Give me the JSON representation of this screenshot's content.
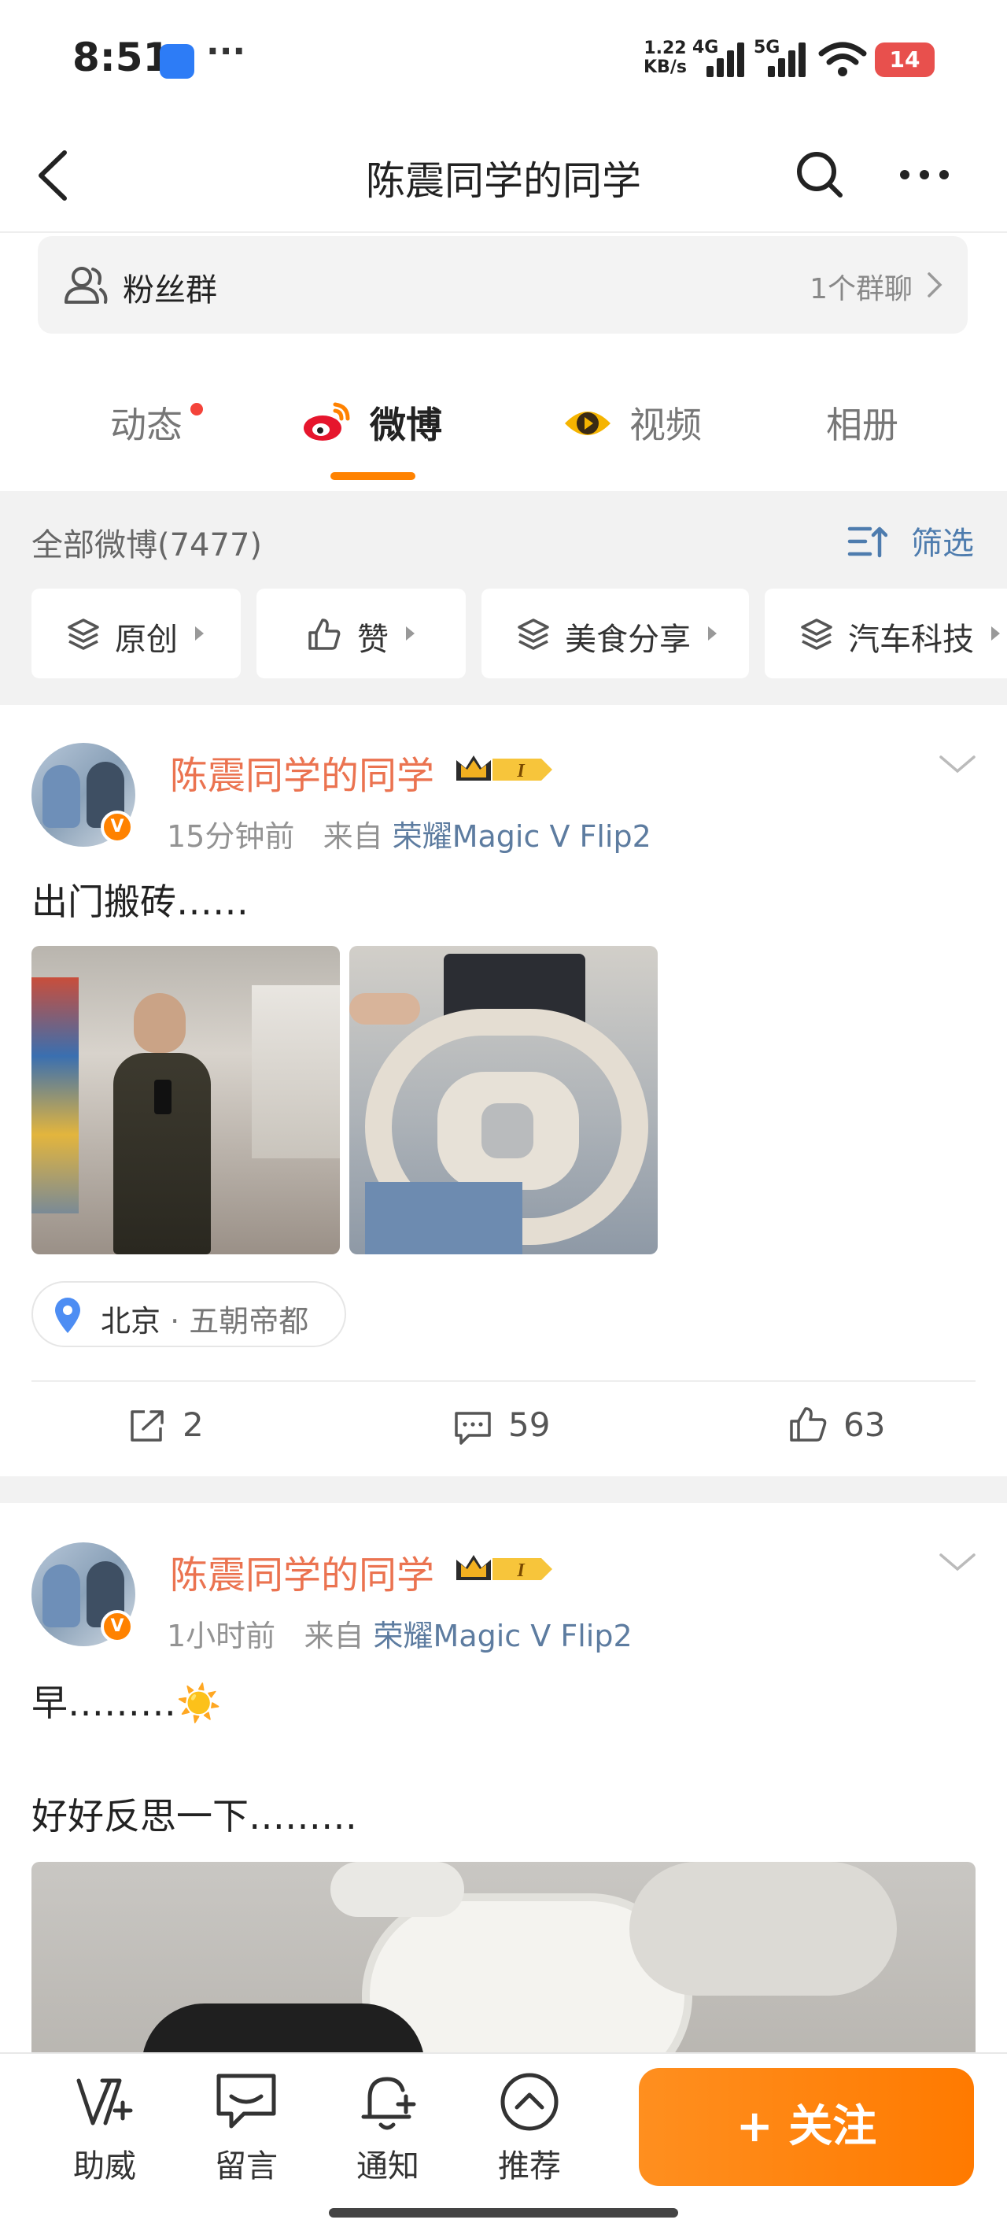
{
  "status_bar": {
    "time": "8:51",
    "more": "···",
    "speed_value": "1.22",
    "speed_unit": "KB/s",
    "net1": "4G",
    "net2": "5G",
    "battery": "14"
  },
  "header": {
    "title": "陈震同学的同学"
  },
  "fan_group": {
    "label": "粉丝群",
    "count": "1个群聊"
  },
  "tabs": [
    {
      "label": "动态",
      "has_dot": true
    },
    {
      "label": "微博",
      "active": true
    },
    {
      "label": "视频"
    },
    {
      "label": "相册"
    }
  ],
  "filter": {
    "all_label": "全部微博(7477)",
    "filter_label": "筛选",
    "chips": [
      "原创",
      "赞",
      "美食分享",
      "汽车科技"
    ]
  },
  "posts": [
    {
      "author": "陈震同学的同学",
      "level": "I",
      "time": "15分钟前",
      "from_label": "来自",
      "source": "荣耀Magic V Flip2",
      "text": "出门搬砖……",
      "location": "北京",
      "location_sub": "· 五朝帝都",
      "reposts": "2",
      "comments": "59",
      "likes": "63"
    },
    {
      "author": "陈震同学的同学",
      "level": "I",
      "time": "1小时前",
      "from_label": "来自",
      "source": "荣耀Magic V Flip2",
      "text_line1": "早………☀️",
      "text_line2": "好好反思一下………"
    }
  ],
  "bottom_bar": {
    "items": [
      "助威",
      "留言",
      "通知",
      "推荐"
    ],
    "follow_label": "+ 关注"
  },
  "colors": {
    "accent": "#ff8200",
    "name": "#eb7350",
    "link": "#5d7ca0"
  }
}
